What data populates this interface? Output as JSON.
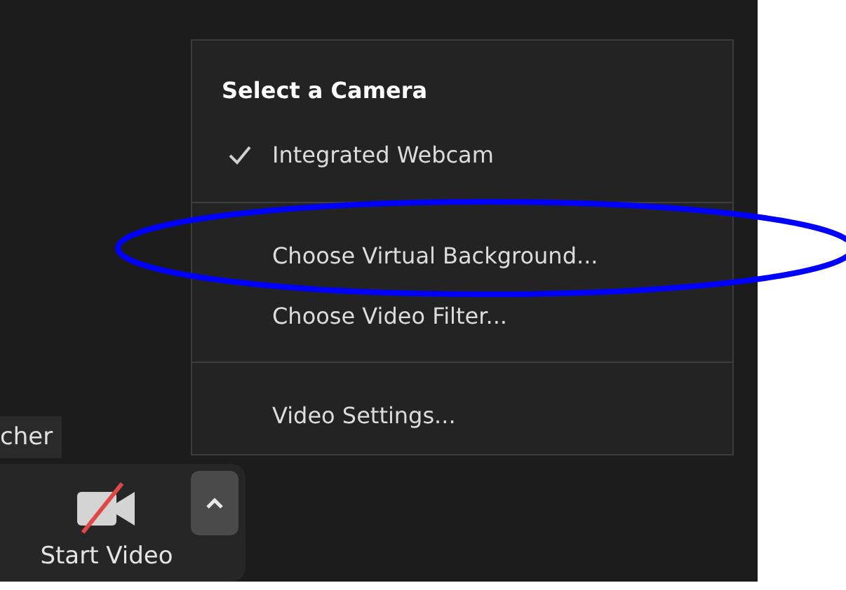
{
  "menu": {
    "title": "Select a Camera",
    "sections": [
      {
        "items": [
          {
            "label": "Integrated Webcam",
            "checked": true
          }
        ]
      },
      {
        "items": [
          {
            "label": "Choose Virtual Background...",
            "checked": false
          },
          {
            "label": "Choose Video Filter...",
            "checked": false
          }
        ]
      },
      {
        "items": [
          {
            "label": "Video Settings...",
            "checked": false
          }
        ]
      }
    ]
  },
  "name_tag": "cher",
  "toolbar": {
    "video_button": {
      "label": "Start Video",
      "muted": true
    }
  },
  "annotation": {
    "kind": "ellipse",
    "color": "#0000ff"
  }
}
